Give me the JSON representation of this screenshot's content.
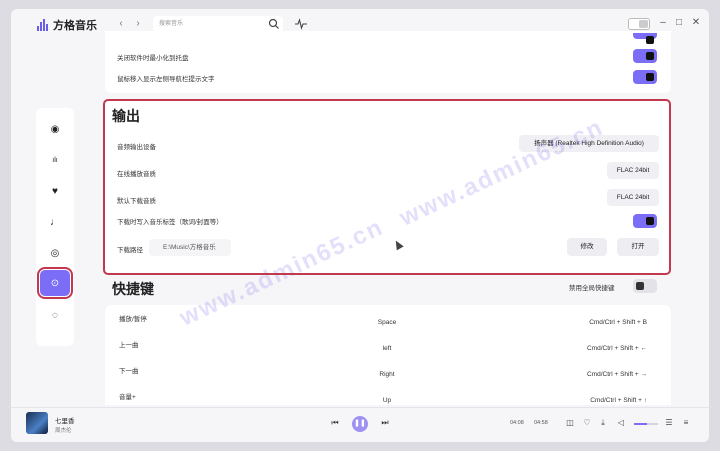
{
  "app": {
    "title": "方格音乐"
  },
  "titlebar": {
    "search_placeholder": "搜索音乐",
    "back_icon": "‹",
    "forward_icon": "›",
    "search_icon": "search-icon",
    "pulse_icon": "pulse-icon",
    "min": "–",
    "max": "□",
    "close": "✕"
  },
  "sidebar": {
    "items": [
      {
        "icon": "disc-icon",
        "glyph": "◉"
      },
      {
        "icon": "chart-icon",
        "glyph": "ılı"
      },
      {
        "icon": "heart-icon",
        "glyph": "♥"
      },
      {
        "icon": "note-icon",
        "glyph": "♩"
      },
      {
        "icon": "compass-icon",
        "glyph": "◎"
      },
      {
        "icon": "settings-toggle-icon",
        "glyph": "⊙",
        "active": true
      },
      {
        "icon": "shield-icon",
        "glyph": "◌"
      }
    ]
  },
  "general": {
    "rows": [
      {
        "label": "关闭软件时最小化到托盘",
        "on": true
      },
      {
        "label": "鼠标移入显示左侧导航栏提示文字",
        "on": true
      }
    ]
  },
  "output": {
    "title": "输出",
    "device_label": "音频输出设备",
    "device_value": "扬声器 (Realtek High Definition Audio)",
    "online_label": "在线播放音质",
    "online_value": "FLAC 24bit",
    "download_label": "默认下载音质",
    "download_value": "FLAC 24bit",
    "tags_label": "下载时写入音乐标签（歌词/封面等）",
    "tags_on": true,
    "path_label": "下载路径",
    "path_value": "E:\\Music\\方格音乐",
    "modify_button": "修改",
    "open_button": "打开"
  },
  "shortcuts": {
    "title": "快捷键",
    "global_label": "禁用全局快捷键",
    "global_on": false,
    "rows": [
      {
        "name": "播放/暂停",
        "key": "Space",
        "global": "Cmd/Ctrl + Shift + B"
      },
      {
        "name": "上一曲",
        "key": "left",
        "global": "Cmd/Ctrl + Shift + ←"
      },
      {
        "name": "下一曲",
        "key": "Right",
        "global": "Cmd/Ctrl + Shift + →"
      },
      {
        "name": "音量+",
        "key": "Up",
        "global": "Cmd/Ctrl + Shift + ↑"
      }
    ]
  },
  "watermark": {
    "text1": "www.admin65.cn",
    "text2": "www.admin65.cn"
  },
  "player": {
    "song": "七里香",
    "artist": "周杰伦",
    "current_time": "04:08",
    "total_time": "04:58",
    "prev": "⏮",
    "pause": "❚❚",
    "next": "⏭",
    "volume_level": 0.55
  },
  "colors": {
    "accent": "#7b6df5",
    "highlight_border": "#c2384e"
  }
}
